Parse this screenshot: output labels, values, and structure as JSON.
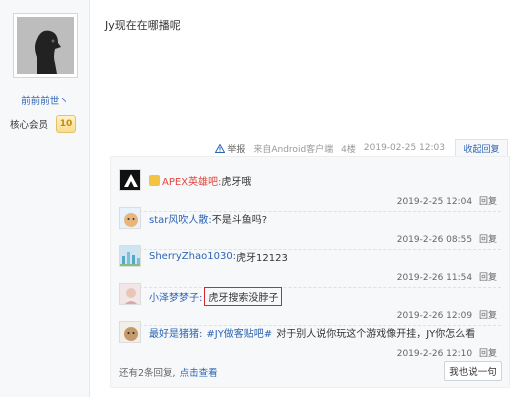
{
  "user": {
    "name": "前前前世丶",
    "member_label": "核心会员",
    "level": "10"
  },
  "post": {
    "content": "Jy现在在哪播呢",
    "report": "举报",
    "client": "来自Android客户端",
    "floor": "4楼",
    "time": "2019-02-25 12:03",
    "fold": "收起回复"
  },
  "replies": [
    {
      "name": "APEX英雄吧:",
      "text": "虎牙哦",
      "time": "2019-2-25 12:04",
      "reply": "回复",
      "name_color": "#e1463e"
    },
    {
      "name": "star风吹人散:",
      "text": "不是斗鱼吗?",
      "time": "2019-2-26 08:55",
      "reply": "回复",
      "name_color": "#2d64b3"
    },
    {
      "name": "SherryZhao1030:",
      "text": "虎牙12123",
      "time": "2019-2-26 11:54",
      "reply": "回复",
      "name_color": "#2d64b3"
    },
    {
      "name": "小泽梦梦子:",
      "text": "虎牙搜索没脖子",
      "time": "2019-2-26 12:09",
      "reply": "回复",
      "name_color": "#2d64b3"
    },
    {
      "name": "最好是猪猪:",
      "topic": "#JY做客贴吧#",
      "text": "对于别人说你玩这个游戏像开挂，JY你怎么看",
      "time": "2019-2-26 12:10",
      "reply": "回复",
      "name_color": "#2d64b3"
    }
  ],
  "footer": {
    "more_text": "还有2条回复,",
    "more_link": "点击查看",
    "say_button": "我也说一句"
  }
}
